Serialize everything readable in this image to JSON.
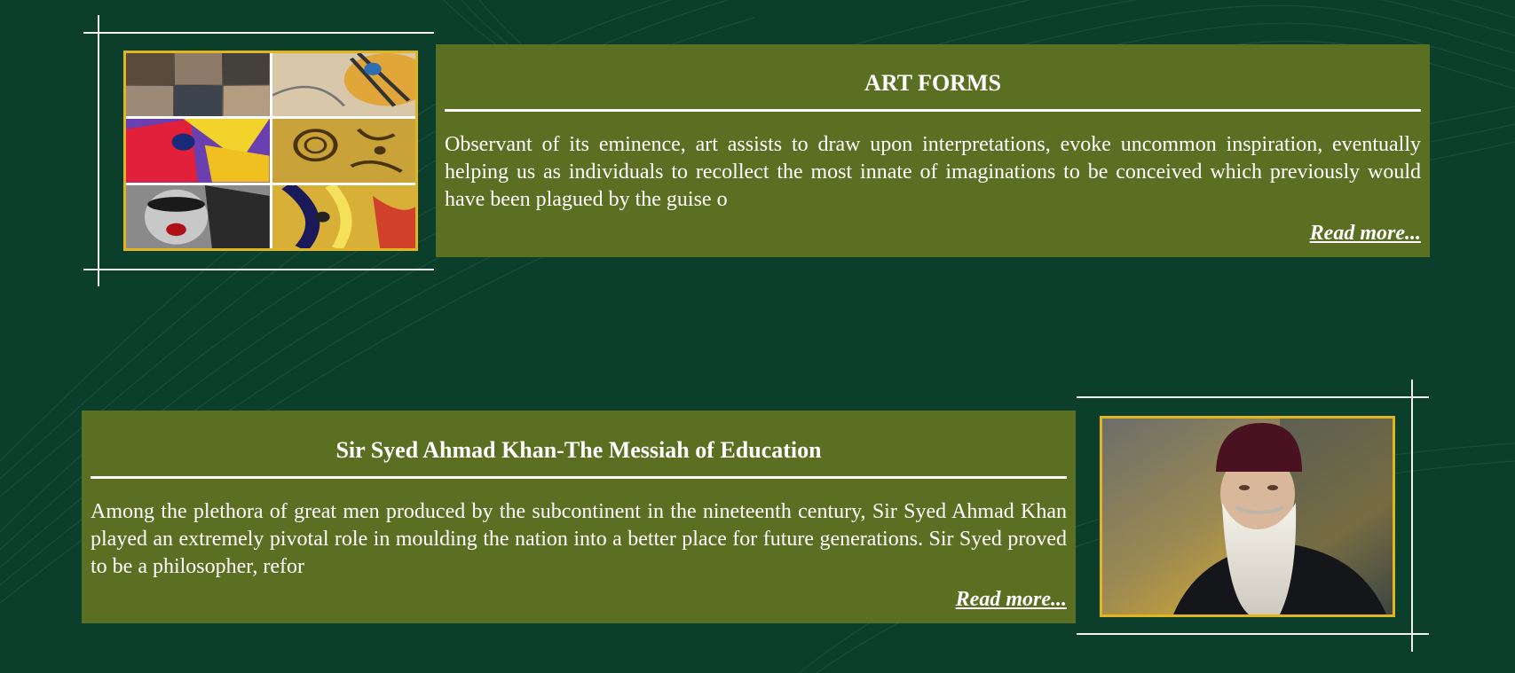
{
  "colors": {
    "background": "#0b3f2c",
    "card": "#5a6f22",
    "image_border": "#e2b41e",
    "frame": "#f1f1f1"
  },
  "sections": [
    {
      "title": "ART FORMS",
      "text": "Observant of its eminence, art assists to draw upon interpretations, evoke uncommon inspiration, eventually helping us as individuals to recollect the most innate of imaginations to be conceived which previously would have been plagued by the guise o",
      "read_more": "Read more...",
      "image": "art-collage"
    },
    {
      "title": "Sir Syed Ahmad Khan-The Messiah of Education",
      "text": "Among the plethora of great men produced by the subcontinent in the nineteenth century, Sir Syed Ahmad Khan played an extremely pivotal role in moulding the nation into a better place for future generations. Sir Syed proved to be a philosopher, refor",
      "read_more": "Read more...",
      "image": "portrait-sir-syed"
    }
  ]
}
